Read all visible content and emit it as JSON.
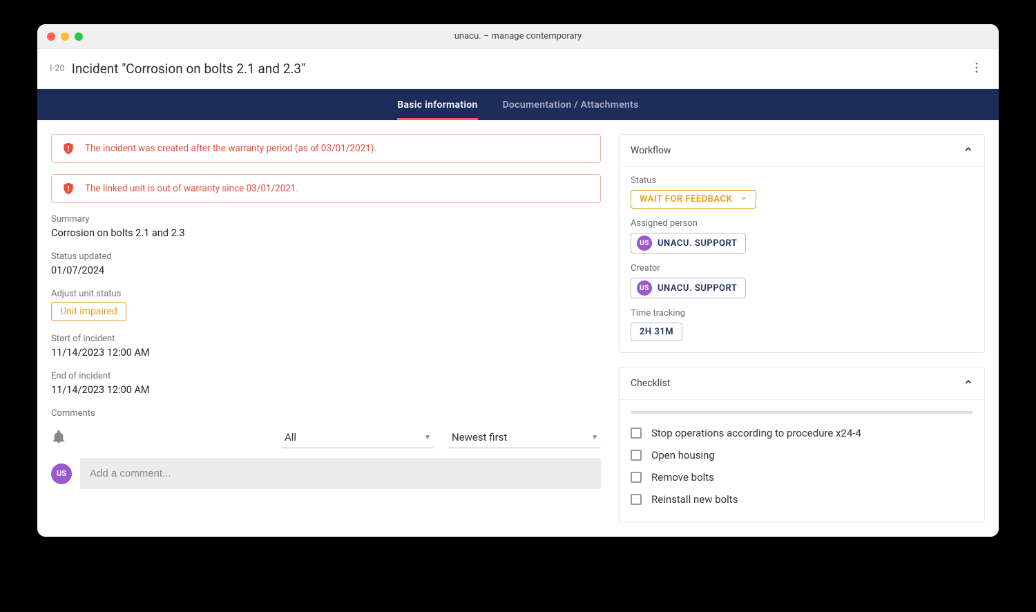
{
  "window_title": "unacu. – manage contemporary",
  "incident": {
    "id": "I-20",
    "title": "Incident \"Corrosion on bolts 2.1 and 2.3\""
  },
  "tabs": {
    "basic": "Basic information",
    "docs": "Documentation / Attachments"
  },
  "alerts": [
    "The incident was created after the warranty period (as of 03/01/2021).",
    "The linked unit is out of warranty since 03/01/2021."
  ],
  "fields": {
    "summary_label": "Summary",
    "summary_value": "Corrosion on bolts 2.1 and 2.3",
    "status_updated_label": "Status updated",
    "status_updated_value": "01/07/2024",
    "adjust_status_label": "Adjust unit status",
    "adjust_status_value": "Unit impaired",
    "start_label": "Start of incident",
    "start_value": "11/14/2023 12:00 AM",
    "end_label": "End of incident",
    "end_value": "11/14/2023 12:00 AM"
  },
  "comments": {
    "label": "Comments",
    "filter": "All",
    "sort": "Newest first",
    "placeholder": "Add a comment...",
    "avatar_initials": "US"
  },
  "workflow": {
    "title": "Workflow",
    "status_label": "Status",
    "status_value": "WAIT FOR FEEDBACK",
    "assigned_label": "Assigned person",
    "assigned_value": "UNACU. SUPPORT",
    "assigned_initials": "US",
    "creator_label": "Creator",
    "creator_value": "UNACU. SUPPORT",
    "creator_initials": "US",
    "time_label": "Time tracking",
    "time_value": "2H 31M"
  },
  "checklist": {
    "title": "Checklist",
    "items": [
      "Stop operations according to procedure x24-4",
      "Open housing",
      "Remove bolts",
      "Reinstall new bolts"
    ]
  }
}
